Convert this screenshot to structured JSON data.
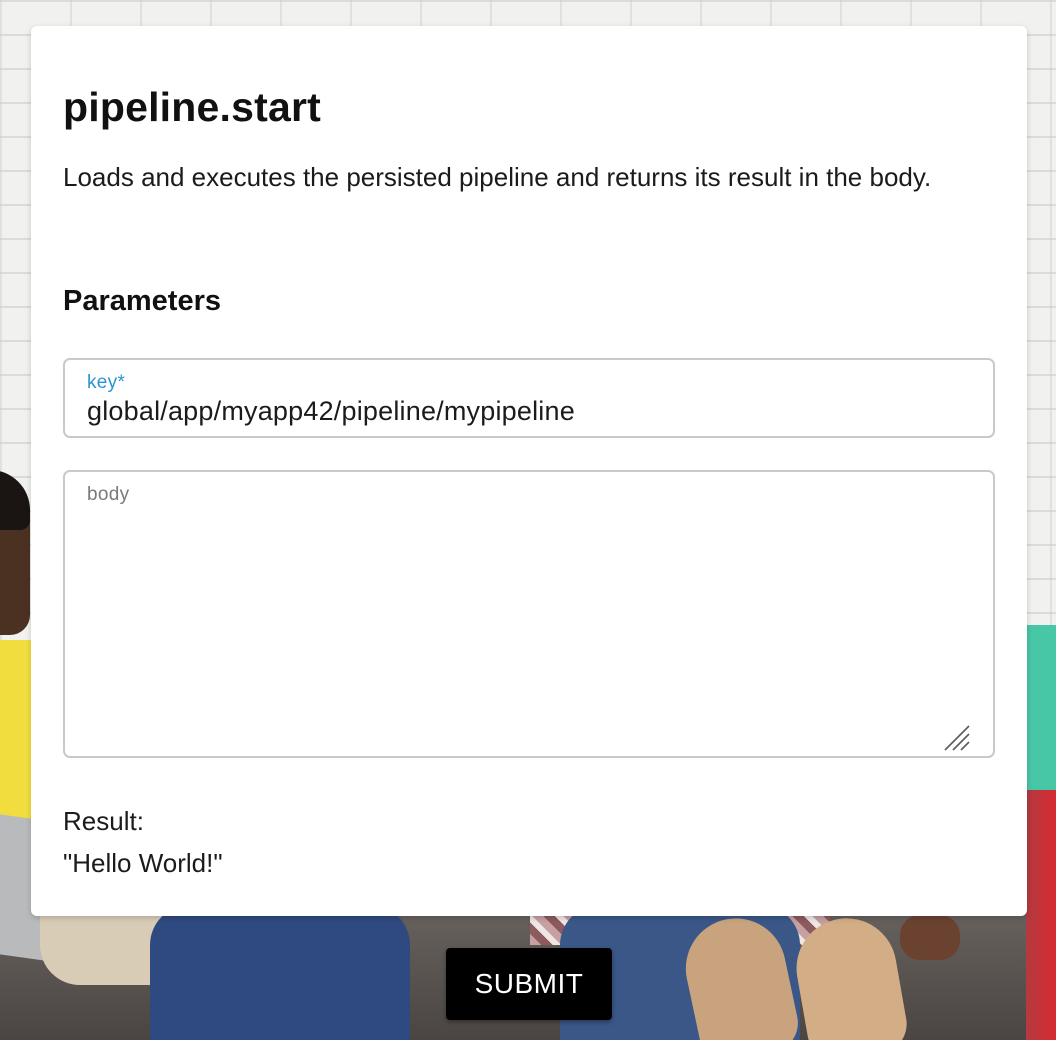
{
  "card": {
    "title": "pipeline.start",
    "description": "Loads and executes the persisted pipeline and returns its result in the body.",
    "parameters_heading": "Parameters"
  },
  "fields": {
    "key": {
      "label": "key*",
      "value": "global/app/myapp42/pipeline/mypipeline"
    },
    "body": {
      "label": "body",
      "value": ""
    }
  },
  "result": {
    "label": "Result:",
    "value": "\"Hello World!\""
  },
  "actions": {
    "submit_label": "SUBMIT"
  },
  "colors": {
    "accent_label": "#2a94d6",
    "button_bg": "#000000",
    "button_text": "#ffffff"
  }
}
